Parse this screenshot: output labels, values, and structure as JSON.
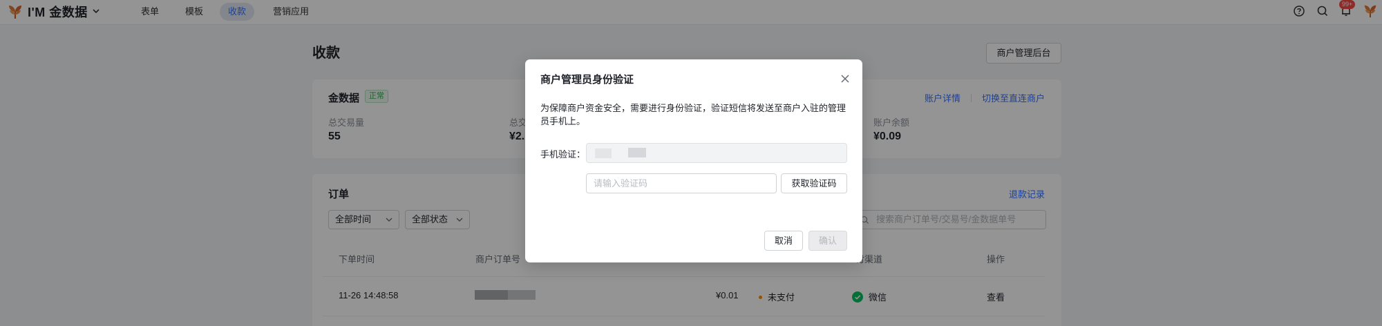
{
  "header": {
    "app_name": "I'M 金数据",
    "nav": [
      {
        "label": "表单"
      },
      {
        "label": "模板"
      },
      {
        "label": "收款",
        "active": true
      },
      {
        "label": "营销应用"
      }
    ],
    "notification_count": "99+",
    "icons": [
      "logo-icon",
      "chevron-down-icon",
      "help-icon",
      "search-icon",
      "bell-icon",
      "avatar"
    ]
  },
  "page": {
    "title": "收款",
    "merchant_admin_button": "商户管理后台"
  },
  "summary": {
    "title": "金数据",
    "status": "正常",
    "links": {
      "account_details": "账户详情",
      "switch_direct": "切换至直连商户"
    },
    "metrics": [
      {
        "label": "总交易量",
        "value": "55"
      },
      {
        "label": "总交",
        "value": "¥2."
      },
      {
        "label": "账户余额",
        "value": "¥0.09"
      }
    ]
  },
  "orders": {
    "title": "订单",
    "refund_link": "退款记录",
    "filters": {
      "time": "全部时间",
      "status": "全部状态"
    },
    "search_placeholder": "搜索商户订单号/交易号/金数据单号",
    "columns": [
      "下单时间",
      "商户订单号",
      "付渠道",
      "操作"
    ],
    "rows": [
      {
        "time": "11-26 14:48:58",
        "amount": "¥0.01",
        "status": "未支付",
        "channel": "微信",
        "action": "查看"
      }
    ]
  },
  "modal": {
    "title": "商户管理员身份验证",
    "description": "为保障商户资金安全，需要进行身份验证，验证短信将发送至商户入驻的管理员手机上。",
    "phone_label": "手机验证：",
    "code_placeholder": "请输入验证码",
    "get_code_button": "获取验证码",
    "cancel_button": "取消",
    "confirm_button": "确认"
  },
  "colors": {
    "accent": "#3370ff",
    "status_ok": "#34a853",
    "unpaid": "#ff8800",
    "wechat": "#07c160",
    "badge": "#f54a45"
  }
}
